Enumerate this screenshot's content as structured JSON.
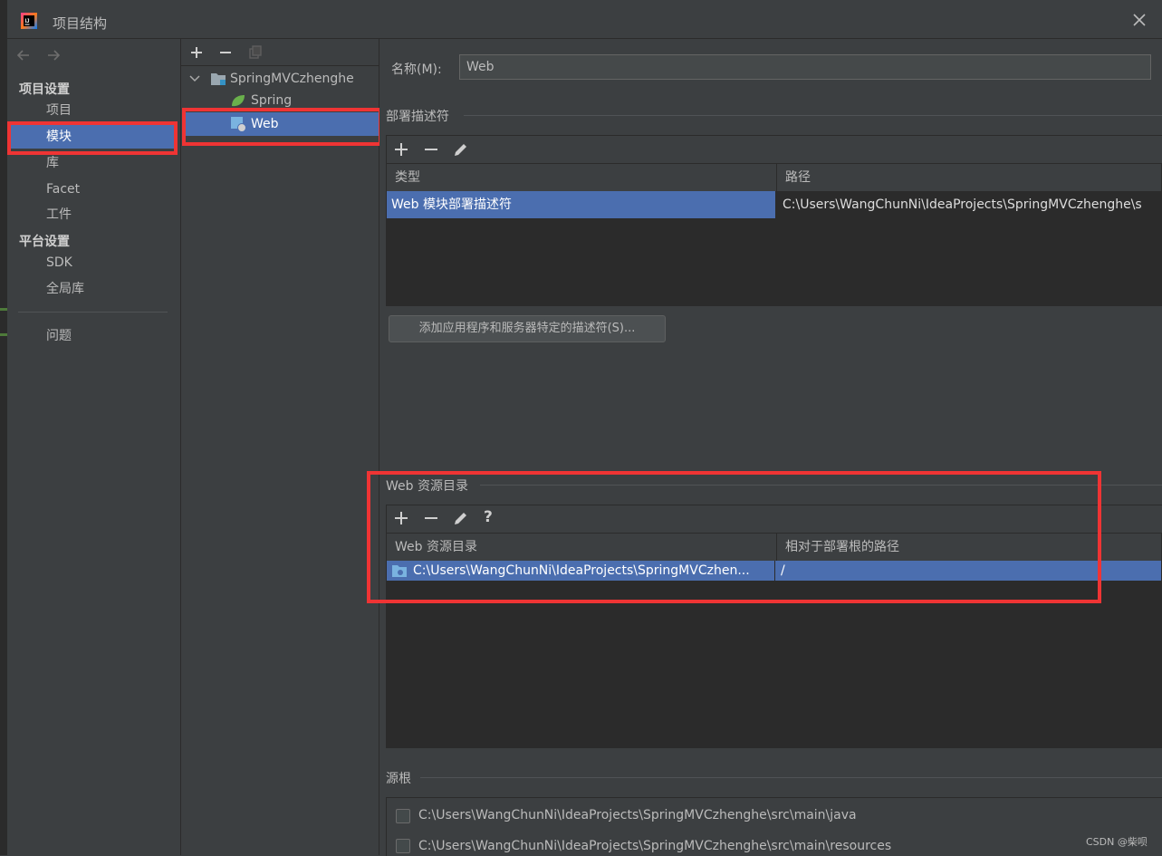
{
  "window": {
    "title": "项目结构",
    "watermark": "CSDN @柴呗"
  },
  "nav": {
    "project_settings_header": "项目设置",
    "platform_settings_header": "平台设置",
    "items": {
      "project": "项目",
      "modules": "模块",
      "libraries": "库",
      "facets": "Facet",
      "artifacts": "工件",
      "sdk": "SDK",
      "global_libraries": "全局库",
      "problems": "问题"
    },
    "selected": "模块"
  },
  "tree": {
    "root": "SpringMVCzhenghe",
    "children": [
      "Spring",
      "Web"
    ],
    "selected": "Web"
  },
  "facet": {
    "name_label": "名称(M):",
    "name_value": "Web",
    "descriptors": {
      "title": "部署描述符",
      "columns": [
        "类型",
        "路径"
      ],
      "rows": [
        {
          "type": "Web 模块部署描述符",
          "path": "C:\\Users\\WangChunNi\\IdeaProjects\\SpringMVCzhenghe\\s"
        }
      ],
      "add_button": "添加应用程序和服务器特定的描述符(S)..."
    },
    "web_resources": {
      "title": "Web 资源目录",
      "columns": [
        "Web 资源目录",
        "相对于部署根的路径"
      ],
      "rows": [
        {
          "dir": "C:\\Users\\WangChunNi\\IdeaProjects\\SpringMVCzhen...",
          "path": "/"
        }
      ],
      "help": "?"
    },
    "source_roots": {
      "title": "源根",
      "items": [
        "C:\\Users\\WangChunNi\\IdeaProjects\\SpringMVCzhenghe\\src\\main\\java",
        "C:\\Users\\WangChunNi\\IdeaProjects\\SpringMVCzhenghe\\src\\main\\resources"
      ]
    }
  },
  "colors": {
    "background": "#3c3f41",
    "table_background": "#2b2b2b",
    "selection": "#4b6eaf",
    "highlight_box": "#ef3434",
    "spring_leaf": "#6ab04c"
  }
}
